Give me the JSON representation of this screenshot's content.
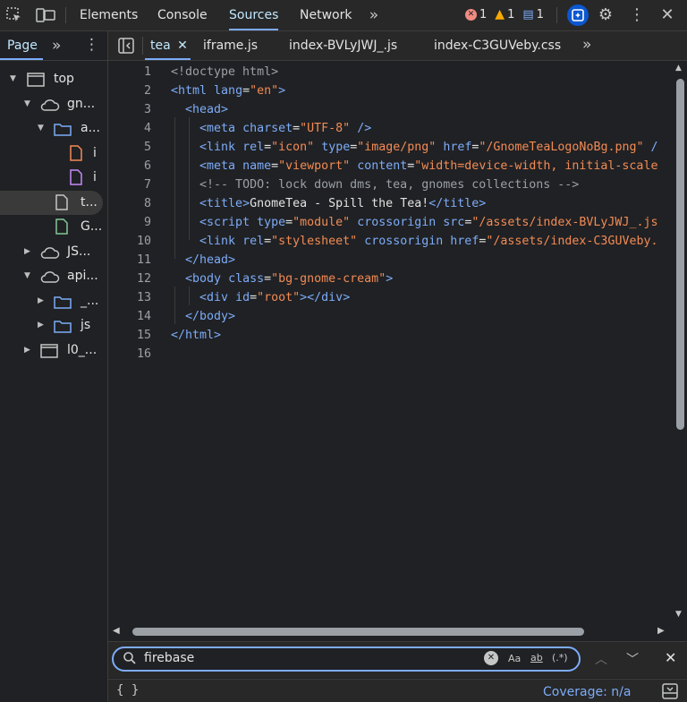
{
  "toolbar": {
    "tabs": [
      "Elements",
      "Console",
      "Sources",
      "Network"
    ],
    "active_tab": "Sources",
    "errors": "1",
    "warnings": "1",
    "messages": "1",
    "colors": {
      "error": "#f28b82",
      "warning": "#f9ab00",
      "info": "#7cacf8"
    }
  },
  "navigator": {
    "tab": "Page",
    "items": [
      {
        "label": "top",
        "icon": "frame-icon"
      },
      {
        "label": "gn...",
        "icon": "cloud-icon"
      },
      {
        "label": "a...",
        "icon": "folder-icon"
      },
      {
        "label": "i",
        "icon": "file-icon"
      },
      {
        "label": "i",
        "icon": "file-icon"
      },
      {
        "label": "t...",
        "icon": "file-icon"
      },
      {
        "label": "G...",
        "icon": "file-icon"
      },
      {
        "label": "JS...",
        "icon": "cloud-icon"
      },
      {
        "label": "api...",
        "icon": "cloud-icon"
      },
      {
        "label": "_...",
        "icon": "folder-icon"
      },
      {
        "label": "js",
        "icon": "folder-icon"
      },
      {
        "label": "l0_...",
        "icon": "frame-icon"
      }
    ]
  },
  "editor": {
    "tabs": [
      "tea",
      "iframe.js",
      "index-BVLyJWJ_.js",
      "index-C3GUVeby.css"
    ],
    "active_tab": "tea",
    "line_numbers": [
      "1",
      "2",
      "3",
      "4",
      "5",
      "6",
      "7",
      "8",
      "9",
      "10",
      "11",
      "12",
      "13",
      "14",
      "15",
      "16"
    ]
  },
  "search": {
    "value": "firebase",
    "match_case": "Aa",
    "whole_word": "ab",
    "regex": "(.*)"
  },
  "status": {
    "pretty_print": "{ }",
    "coverage": "Coverage: n/a"
  }
}
